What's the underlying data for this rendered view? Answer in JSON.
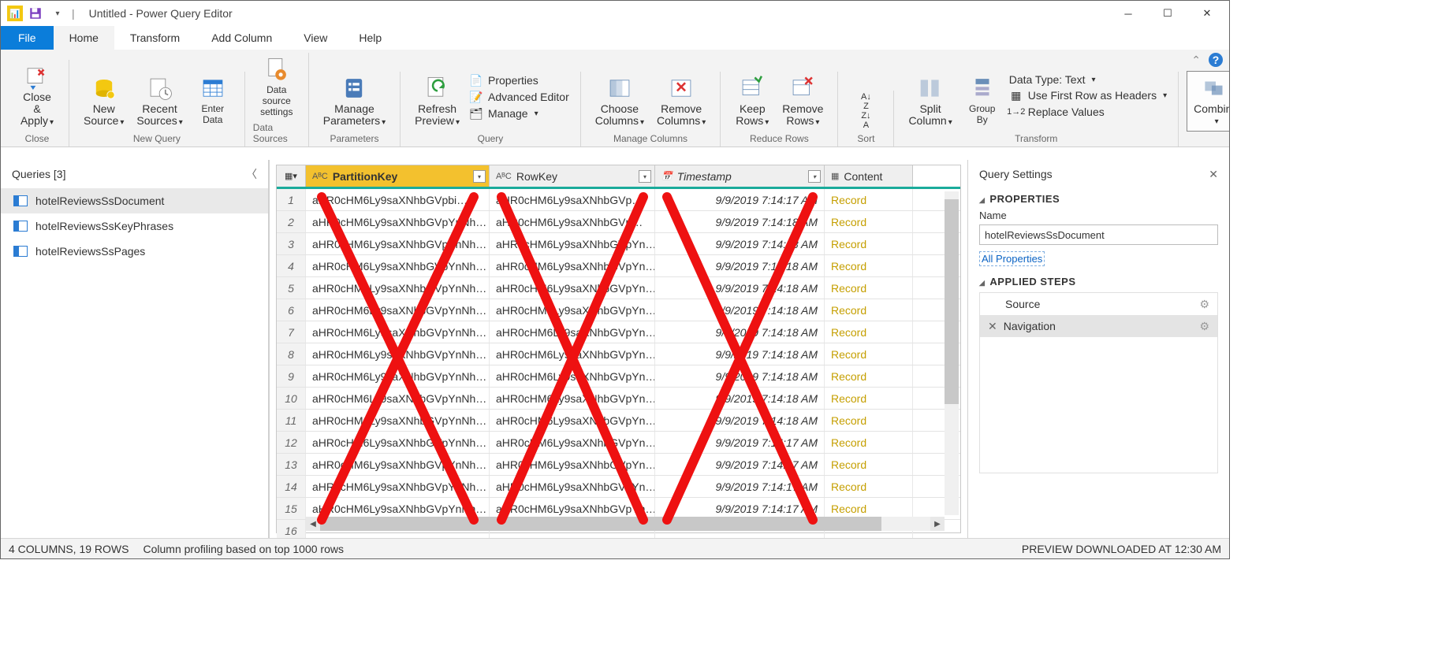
{
  "titlebar": {
    "title": "Untitled - Power Query Editor"
  },
  "menu": {
    "file": "File",
    "home": "Home",
    "transform": "Transform",
    "addcol": "Add Column",
    "view": "View",
    "help": "Help"
  },
  "ribbon": {
    "close_apply": "Close &\nApply",
    "close": "Close",
    "new_source": "New\nSource",
    "recent_sources": "Recent\nSources",
    "enter_data": "Enter\nData",
    "new_query": "New Query",
    "data_source": "Data source\nsettings",
    "data_sources": "Data Sources",
    "manage_params": "Manage\nParameters",
    "parameters": "Parameters",
    "refresh": "Refresh\nPreview",
    "properties": "Properties",
    "advanced": "Advanced Editor",
    "manage": "Manage",
    "query": "Query",
    "choose_cols": "Choose\nColumns",
    "remove_cols": "Remove\nColumns",
    "manage_cols": "Manage Columns",
    "keep_rows": "Keep\nRows",
    "remove_rows": "Remove\nRows",
    "reduce_rows": "Reduce Rows",
    "sort": "Sort",
    "split_col": "Split\nColumn",
    "group_by": "Group\nBy",
    "data_type": "Data Type: Text",
    "first_row": "Use First Row as Headers",
    "replace": "Replace Values",
    "transform": "Transform",
    "combine": "Combine"
  },
  "queries": {
    "title": "Queries [3]",
    "items": [
      {
        "label": "hotelReviewsSsDocument"
      },
      {
        "label": "hotelReviewsSsKeyPhrases"
      },
      {
        "label": "hotelReviewsSsPages"
      }
    ]
  },
  "grid": {
    "headers": {
      "pk": "PartitionKey",
      "rk": "RowKey",
      "ts": "Timestamp",
      "ct": "Content"
    },
    "rows": [
      {
        "i": "1",
        "pk": "aHR0cHM6Ly9saXNhbGVpbi…",
        "rk": "aHR0cHM6Ly9saXNhbGVp…",
        "ts": "9/9/2019 7:14:17 AM",
        "ct": "Record"
      },
      {
        "i": "2",
        "pk": "aHR0cHM6Ly9saXNhbGVpYnNh…",
        "rk": "aHR0cHM6Ly9saXNhbGVp…",
        "ts": "9/9/2019 7:14:18 AM",
        "ct": "Record"
      },
      {
        "i": "3",
        "pk": "aHR0cHM6Ly9saXNhbGVpYnNh…",
        "rk": "aHR0cHM6Ly9saXNhbGVpYn…",
        "ts": "9/9/2019 7:14:18 AM",
        "ct": "Record"
      },
      {
        "i": "4",
        "pk": "aHR0cHM6Ly9saXNhbGVpYnNh…",
        "rk": "aHR0cHM6Ly9saXNhbGVpYn…",
        "ts": "9/9/2019 7:14:18 AM",
        "ct": "Record"
      },
      {
        "i": "5",
        "pk": "aHR0cHM6Ly9saXNhbGVpYnNh…",
        "rk": "aHR0cHM6Ly9saXNhbGVpYn…",
        "ts": "9/9/2019 7:14:18 AM",
        "ct": "Record"
      },
      {
        "i": "6",
        "pk": "aHR0cHM6Ly9saXNhbGVpYnNh…",
        "rk": "aHR0cHM6Ly9saXNhbGVpYn…",
        "ts": "9/9/2019 7:14:18 AM",
        "ct": "Record"
      },
      {
        "i": "7",
        "pk": "aHR0cHM6Ly9saXNhbGVpYnNh…",
        "rk": "aHR0cHM6Ly9saXNhbGVpYn…",
        "ts": "9/9/2019 7:14:18 AM",
        "ct": "Record"
      },
      {
        "i": "8",
        "pk": "aHR0cHM6Ly9saXNhbGVpYnNh…",
        "rk": "aHR0cHM6Ly9saXNhbGVpYn…",
        "ts": "9/9/2019 7:14:18 AM",
        "ct": "Record"
      },
      {
        "i": "9",
        "pk": "aHR0cHM6Ly9saXNhbGVpYnNh…",
        "rk": "aHR0cHM6Ly9saXNhbGVpYn…",
        "ts": "9/9/2019 7:14:18 AM",
        "ct": "Record"
      },
      {
        "i": "10",
        "pk": "aHR0cHM6Ly9saXNhbGVpYnNh…",
        "rk": "aHR0cHM6Ly9saXNhbGVpYn…",
        "ts": "9/9/2019 7:14:18 AM",
        "ct": "Record"
      },
      {
        "i": "11",
        "pk": "aHR0cHM6Ly9saXNhbGVpYnNh…",
        "rk": "aHR0cHM6Ly9saXNhbGVpYn…",
        "ts": "9/9/2019 7:14:18 AM",
        "ct": "Record"
      },
      {
        "i": "12",
        "pk": "aHR0cHM6Ly9saXNhbGVpYnNh…",
        "rk": "aHR0cHM6Ly9saXNhbGVpYn…",
        "ts": "9/9/2019 7:14:17 AM",
        "ct": "Record"
      },
      {
        "i": "13",
        "pk": "aHR0cHM6Ly9saXNhbGVpYnNh…",
        "rk": "aHR0cHM6Ly9saXNhbGVpYn…",
        "ts": "9/9/2019 7:14:17 AM",
        "ct": "Record"
      },
      {
        "i": "14",
        "pk": "aHR0cHM6Ly9saXNhbGVpYnNh…",
        "rk": "aHR0cHM6Ly9saXNhbGVpYn…",
        "ts": "9/9/2019 7:14:17 AM",
        "ct": "Record"
      },
      {
        "i": "15",
        "pk": "aHR0cHM6Ly9saXNhbGVpYnNh…",
        "rk": "aHR0cHM6Ly9saXNhbGVpYn…",
        "ts": "9/9/2019 7:14:17 AM",
        "ct": "Record"
      },
      {
        "i": "16",
        "pk": "",
        "rk": "",
        "ts": "",
        "ct": ""
      }
    ]
  },
  "settings": {
    "title": "Query Settings",
    "props": "PROPERTIES",
    "name": "Name",
    "name_val": "hotelReviewsSsDocument",
    "all_props": "All Properties",
    "steps_title": "APPLIED STEPS",
    "steps": [
      {
        "label": "Source"
      },
      {
        "label": "Navigation"
      }
    ]
  },
  "status": {
    "left": "4 COLUMNS, 19 ROWS",
    "mid": "Column profiling based on top 1000 rows",
    "right": "PREVIEW DOWNLOADED AT 12:30 AM"
  }
}
